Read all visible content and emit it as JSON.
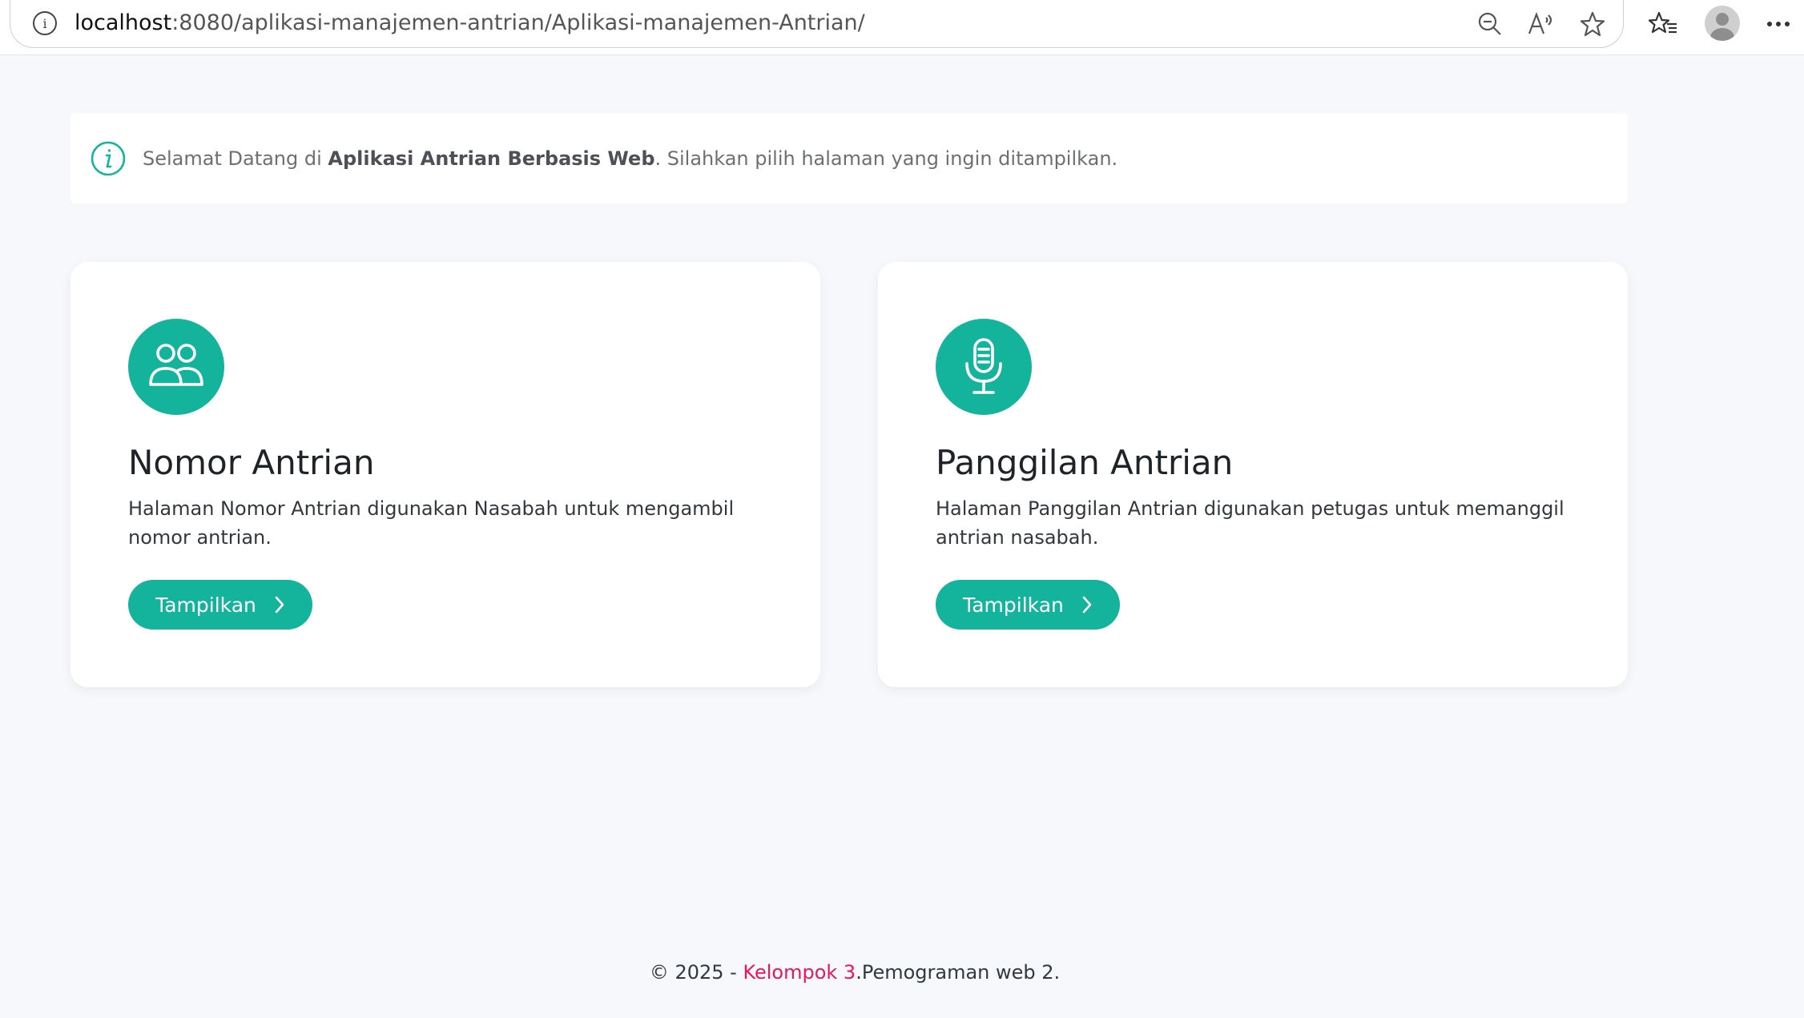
{
  "browser": {
    "url_host": "localhost",
    "url_path": ":8080/aplikasi-manajemen-antrian/Aplikasi-manajemen-Antrian/",
    "icons": [
      "site-info-icon",
      "zoom-out-icon",
      "read-aloud-icon",
      "favorite-star-icon",
      "favorites-list-icon",
      "profile-avatar",
      "more-options-icon"
    ]
  },
  "alert": {
    "prefix": "Selamat Datang di ",
    "bold": "Aplikasi Antrian Berbasis Web",
    "suffix": ". Silahkan pilih halaman yang ingin ditampilkan."
  },
  "cards": [
    {
      "icon": "people-icon",
      "title": "Nomor Antrian",
      "description": "Halaman Nomor Antrian digunakan Nasabah untuk mengambil nomor antrian.",
      "button": "Tampilkan"
    },
    {
      "icon": "microphone-icon",
      "title": "Panggilan Antrian",
      "description": "Halaman Panggilan Antrian digunakan petugas untuk memanggil antrian nasabah.",
      "button": "Tampilkan"
    }
  ],
  "footer": {
    "prefix": "© 2025 - ",
    "link": "Kelompok 3",
    "suffix": ".Pemograman web 2."
  },
  "colors": {
    "accent": "#14b39b",
    "footer_link": "#e8175d",
    "page_bg": "#f7f8fb"
  }
}
